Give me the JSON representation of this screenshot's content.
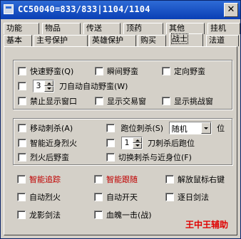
{
  "window": {
    "title": "CC50040=833/833|1104/1104",
    "close_label": "✕"
  },
  "tabs_top": [
    "功能",
    "物品",
    "传送",
    "顶药",
    "其他",
    "挂机"
  ],
  "tabs_bottom": [
    "基本",
    "主号保护",
    "英雄保护",
    "购买",
    "战士",
    "法道"
  ],
  "active_tab": "战士",
  "group1": {
    "r1": [
      "快速野蛮(Q)",
      "瞬间野蛮",
      "定向野蛮"
    ],
    "r2": {
      "spin_value": "3",
      "label": "刀自动自动野蛮(W)"
    },
    "r3": [
      "禁止显示窗口",
      "显示交易窗",
      "显示挑战窗"
    ]
  },
  "group2": {
    "r1a": "移动刺杀(A)",
    "r1b": "跑位刺杀(S)",
    "r1_combo": "随机",
    "r1_suffix": "位",
    "r2a": "智能近身烈火",
    "r2_spin": "1",
    "r2b": "刀刺杀后跑位",
    "r3a": "烈火后野蛮",
    "r3b": "切换刺杀与近身位(F)"
  },
  "group3": {
    "r1": [
      "智能追踪",
      "智能跟随",
      "解放鼠标右键"
    ],
    "r2": [
      "自动烈火",
      "自动开天",
      "逐日剑法"
    ],
    "r3": [
      "龙影剑法",
      "血魄一击(战)"
    ]
  },
  "footer": "王中王辅助",
  "colors": {
    "titlebar": "#0a3fb5",
    "highlight_red": "#c00000"
  }
}
